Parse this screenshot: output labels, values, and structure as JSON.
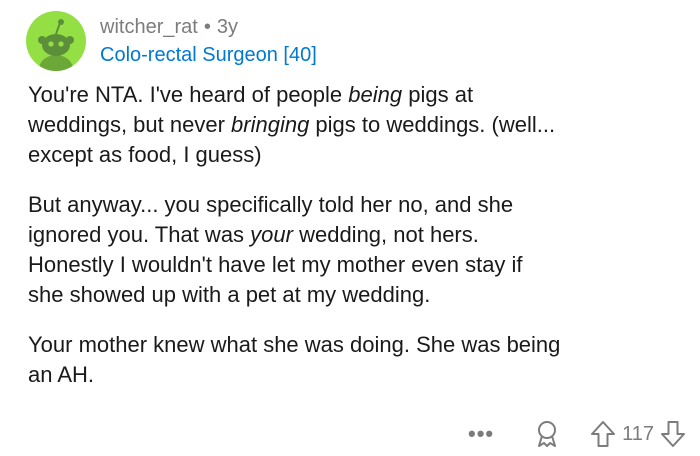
{
  "comment": {
    "author": "witcher_rat",
    "separator": "•",
    "age": "3y",
    "flair": "Colo-rectal Surgeon [40]",
    "paragraphs": [
      [
        "You're NTA. I've heard of people being pigs at",
        "weddings, but never bringing pigs to weddings. (well...",
        "except as food, I guess)"
      ],
      [
        "But anyway... you specifically told her no, and she",
        "ignored you. That was your wedding, not hers.",
        "Honestly I wouldn't have let my mother even stay if",
        "she showed up with a pet at my wedding."
      ],
      [
        "Your mother knew what she was doing. She was being",
        "an AH."
      ]
    ],
    "actions": {
      "more": "•••",
      "score": "117"
    }
  },
  "colors": {
    "avatar_bg": "#94e044",
    "flair": "#0079d3",
    "meta_gray": "#7c7c7c",
    "text": "#1a1a1b"
  },
  "icons": {
    "avatar": "snoo-avatar-icon",
    "award": "award-icon",
    "upvote": "upvote-arrow-icon",
    "downvote": "downvote-arrow-icon",
    "more": "more-options-icon"
  }
}
